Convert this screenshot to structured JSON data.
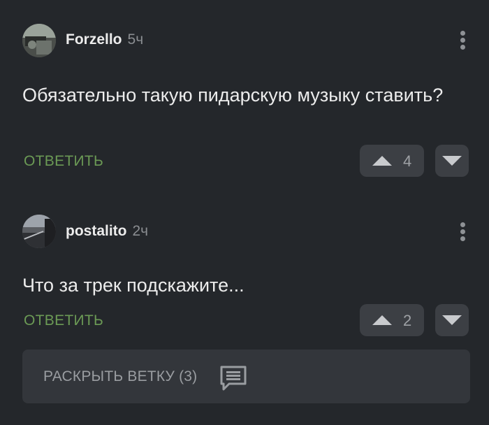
{
  "comments": [
    {
      "author": "Forzello",
      "time": "5ч",
      "text": "Обязательно такую пидарскую музыку ставить?",
      "reply_label": "ОТВЕТИТЬ",
      "votes": "4"
    },
    {
      "author": "postalito",
      "time": "2ч",
      "text": "Что за трек подскажите...",
      "reply_label": "ОТВЕТИТЬ",
      "votes": "2"
    }
  ],
  "expand_thread": {
    "label": "РАСКРЫТЬ ВЕТКУ (3)",
    "icon": "comment-icon"
  },
  "colors": {
    "background": "#24272b",
    "reply": "#6b9a55",
    "button": "#3c3f44"
  }
}
